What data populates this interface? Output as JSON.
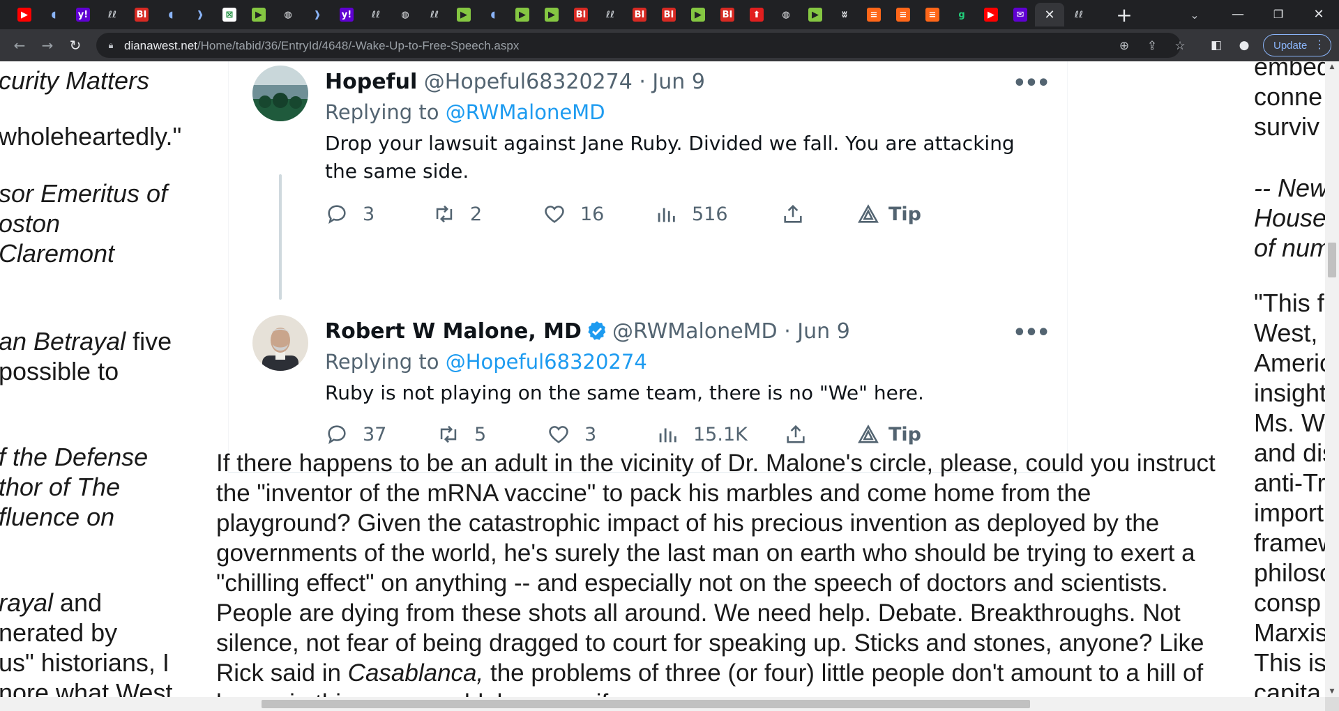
{
  "browser": {
    "tabs": [
      {
        "icon": "youtube-icon",
        "glyph": "▶",
        "color": "#ff0000",
        "fg": "#ffffff"
      },
      {
        "icon": "shield-icon",
        "glyph": "◖",
        "color": "#202124",
        "fg": "#8ab4f8"
      },
      {
        "icon": "yahoo-icon",
        "glyph": "y!",
        "color": "#6001d2",
        "fg": "#ffffff"
      },
      {
        "icon": "article-icon",
        "glyph": "ℓℓ",
        "color": "#202124",
        "fg": "#bdc1c6"
      },
      {
        "icon": "business-insider-icon",
        "glyph": "BI",
        "color": "#d72a23",
        "fg": "#ffffff"
      },
      {
        "icon": "shield-icon",
        "glyph": "◖",
        "color": "#202124",
        "fg": "#8ab4f8"
      },
      {
        "icon": "bookmark-icon",
        "glyph": "❱",
        "color": "#202124",
        "fg": "#8ab4f8"
      },
      {
        "icon": "spreadsheet-icon",
        "glyph": "⊠",
        "color": "#ffffff",
        "fg": "#1e8e3e"
      },
      {
        "icon": "rumble-icon",
        "glyph": "▶",
        "color": "#85c742",
        "fg": "#202124"
      },
      {
        "icon": "globe-icon",
        "glyph": "◍",
        "color": "#202124",
        "fg": "#e8eaed"
      },
      {
        "icon": "bookmark-icon",
        "glyph": "❱",
        "color": "#202124",
        "fg": "#8ab4f8"
      },
      {
        "icon": "yahoo-icon",
        "glyph": "y!",
        "color": "#6001d2",
        "fg": "#ffffff"
      },
      {
        "icon": "article-icon",
        "glyph": "ℓℓ",
        "color": "#202124",
        "fg": "#bdc1c6"
      },
      {
        "icon": "globe-icon",
        "glyph": "◍",
        "color": "#202124",
        "fg": "#e8eaed"
      },
      {
        "icon": "article-icon",
        "glyph": "ℓℓ",
        "color": "#202124",
        "fg": "#bdc1c6"
      },
      {
        "icon": "rumble-icon",
        "glyph": "▶",
        "color": "#85c742",
        "fg": "#202124"
      },
      {
        "icon": "shield-icon",
        "glyph": "◖",
        "color": "#202124",
        "fg": "#8ab4f8"
      },
      {
        "icon": "rumble-icon",
        "glyph": "▶",
        "color": "#85c742",
        "fg": "#202124"
      },
      {
        "icon": "rumble-icon",
        "glyph": "▶",
        "color": "#85c742",
        "fg": "#202124"
      },
      {
        "icon": "business-insider-icon",
        "glyph": "BI",
        "color": "#d72a23",
        "fg": "#ffffff"
      },
      {
        "icon": "article-icon",
        "glyph": "ℓℓ",
        "color": "#202124",
        "fg": "#bdc1c6"
      },
      {
        "icon": "business-insider-icon",
        "glyph": "BI",
        "color": "#d72a23",
        "fg": "#ffffff"
      },
      {
        "icon": "business-insider-icon",
        "glyph": "BI",
        "color": "#d72a23",
        "fg": "#ffffff"
      },
      {
        "icon": "rumble-icon",
        "glyph": "▶",
        "color": "#85c742",
        "fg": "#202124"
      },
      {
        "icon": "business-insider-icon",
        "glyph": "BI",
        "color": "#d72a23",
        "fg": "#ffffff"
      },
      {
        "icon": "upvote-icon",
        "glyph": "⬆",
        "color": "#e11f1f",
        "fg": "#ffffff"
      },
      {
        "icon": "globe-icon",
        "glyph": "◍",
        "color": "#202124",
        "fg": "#e8eaed"
      },
      {
        "icon": "rumble-icon",
        "glyph": "▶",
        "color": "#85c742",
        "fg": "#202124"
      },
      {
        "icon": "news-icon",
        "glyph": "ʬ",
        "color": "#202124",
        "fg": "#e8eaed"
      },
      {
        "icon": "substack-icon",
        "glyph": "≡",
        "color": "#ff6719",
        "fg": "#ffffff"
      },
      {
        "icon": "substack-icon",
        "glyph": "≡",
        "color": "#ff6719",
        "fg": "#ffffff"
      },
      {
        "icon": "substack-icon",
        "glyph": "≡",
        "color": "#ff6719",
        "fg": "#ffffff"
      },
      {
        "icon": "gab-icon",
        "glyph": "g",
        "color": "#202124",
        "fg": "#21cf7a"
      },
      {
        "icon": "youtube-icon",
        "glyph": "▶",
        "color": "#ff0000",
        "fg": "#ffffff"
      },
      {
        "icon": "yahoo-mail-icon",
        "glyph": "✉",
        "color": "#6001d2",
        "fg": "#ffffff"
      },
      {
        "icon": "close-icon",
        "glyph": "✕",
        "color": "#35363a",
        "fg": "#e8eaed",
        "active": true
      },
      {
        "icon": "article-icon",
        "glyph": "ℓℓ",
        "color": "#202124",
        "fg": "#bdc1c6"
      }
    ],
    "url_host": "dianawest.net",
    "url_path": "/Home/tabid/36/EntryId/4648/-Wake-Up-to-Free-Speech.aspx",
    "update_label": "Update"
  },
  "left_column": {
    "l1": "curity Matters",
    "l2": "wholeheartedly.\"",
    "l3": "sor Emeritus of",
    "l4": "oston",
    "l5": "Claremont",
    "l6a": "an Betrayal",
    "l6b": " five",
    "l7": "possible to",
    "l8": "f the Defense",
    "l9": "thor of The",
    "l10": "fluence on",
    "l11a": "rayal",
    "l11b": " and",
    "l12": "nerated by",
    "l13": "us\" historians, I",
    "l14": "nore what West"
  },
  "right_column": {
    "r1": "embed",
    "r2": "conne",
    "r3": "surviv",
    "r4": "-- New",
    "r5": "House",
    "r6": "of num",
    "r7": "\"This f",
    "r8": "West,",
    "r9": "Americ",
    "r10": "insight",
    "r11": "Ms. W",
    "r12": "and dis",
    "r13": "anti-Tr",
    "r14": "import",
    "r15": "framew",
    "r16": "philoso",
    "r17": "consp",
    "r18": "Marxis",
    "r19": "This is",
    "r20": "capita"
  },
  "tweets": [
    {
      "name": "Hopeful",
      "handle": "@Hopeful68320274",
      "date": "· Jun 9",
      "replying_prefix": "Replying to ",
      "replying_to": "@RWMaloneMD",
      "text": "Drop your lawsuit against Jane Ruby. Divided we fall. You are attacking the same side.",
      "replies": "3",
      "retweets": "2",
      "likes": "16",
      "views": "516",
      "tip": "Tip"
    },
    {
      "name": "Robert W Malone, MD",
      "handle": "@RWMaloneMD",
      "date": "· Jun 9",
      "replying_prefix": "Replying to ",
      "replying_to": "@Hopeful68320274",
      "text": "Ruby is not playing on the same team, there is no \"We\" here.",
      "replies": "37",
      "retweets": "5",
      "likes": "3",
      "views": "15.1K",
      "tip": "Tip"
    }
  ],
  "article": {
    "p1": "If there happens to be an adult in the vicinity of Dr. Malone's circle, please, could you instruct the \"inventor of the mRNA vaccine\" to pack his marbles and come home from the playground? Given the catastrophic impact of his precious invention as deployed by the governments of the world, he's surely the last man on earth who should be trying to exert a \"chilling effect\" on anything -- and especially not on the speech of doctors and scientists. People are dying from these shots all around. We need help. Debate. Breakthroughs. Not silence, not fear of being dragged to court for speaking up. Sticks and stones, anyone? Like Rick said in ",
    "p1_italic": "Casablanca,",
    "p1_end": " the problems of three (or four) little people don't amount to a hill of beans in this crazy world, because if"
  },
  "colors": {
    "twitter_blue": "#1d9bf0",
    "twitter_gray": "#536471",
    "chrome_dark": "#202124",
    "chrome_toolbar": "#35363a"
  }
}
